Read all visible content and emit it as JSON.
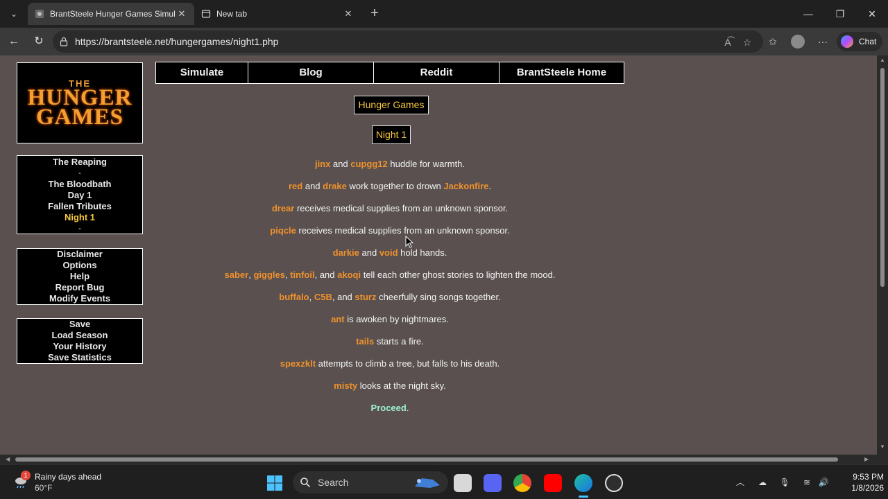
{
  "browser": {
    "tabs": [
      {
        "title": "BrantSteele Hunger Games Simula",
        "active": true
      },
      {
        "title": "New tab",
        "active": false
      }
    ],
    "url": "https://brantsteele.net/hungergames/night1.php",
    "copilot_label": "Chat"
  },
  "site": {
    "logo": {
      "line1": "THE",
      "line2": "HUNGER",
      "line3": "GAMES"
    },
    "top_nav": [
      "Simulate",
      "Blog",
      "Reddit",
      "BrantSteele Home"
    ],
    "progress_menu": [
      "The Reaping",
      "-",
      "The Bloodbath",
      "Day 1",
      "Fallen Tributes",
      "Night 1",
      "-"
    ],
    "info_menu": [
      "Disclaimer",
      "Options",
      "Help",
      "Report Bug",
      "Modify Events"
    ],
    "save_menu": [
      "Save",
      "Load Season",
      "Your History",
      "Save Statistics"
    ],
    "game_title": "Hunger Games",
    "phase_title": "Night 1",
    "colors": {
      "background": "#59504f",
      "tribute": "#f0922c",
      "current": "#f6c842",
      "proceed": "#9ef0ce"
    }
  },
  "events": [
    {
      "n1": "jinx",
      "t1": " and ",
      "n2": "cupgg12",
      "t2": " huddle for warmth."
    },
    {
      "n1": "red",
      "t1": " and ",
      "n2": "drake",
      "t2": " work together to drown ",
      "n3": "Jackonfire",
      "t3": "."
    },
    {
      "n1": "drear",
      "t1": " receives medical supplies from an unknown sponsor."
    },
    {
      "n1": "piqcle",
      "t1": " receives medical supplies from an unknown sponsor."
    },
    {
      "n1": "darkie",
      "t1": " and ",
      "n2": "void",
      "t2": " hold hands."
    },
    {
      "n1": "saber",
      "t1": ", ",
      "n2": "giggles",
      "t2": ", ",
      "n3": "tinfoil",
      "t3": ", and ",
      "n4": "akoqi",
      "t4": " tell each other ghost stories to lighten the mood."
    },
    {
      "n1": "buffalo",
      "t1": ", ",
      "n2": "C5B",
      "t2": ", and ",
      "n3": "sturz",
      "t3": " cheerfully sing songs together."
    },
    {
      "n1": "ant",
      "t1": " is awoken by nightmares."
    },
    {
      "n1": "tails",
      "t1": " starts a fire."
    },
    {
      "n1": "spexzklt",
      "t1": " attempts to climb a tree, but falls to his death."
    },
    {
      "n1": "misty",
      "t1": " looks at the night sky."
    }
  ],
  "proceed": {
    "link": "Proceed",
    "tail": "."
  },
  "taskbar": {
    "weather_badge": "1",
    "weather_title": "Rainy days ahead",
    "weather_temp": "60°F",
    "search_label": "Search",
    "time": "9:53 PM",
    "date": "1/8/2026"
  }
}
